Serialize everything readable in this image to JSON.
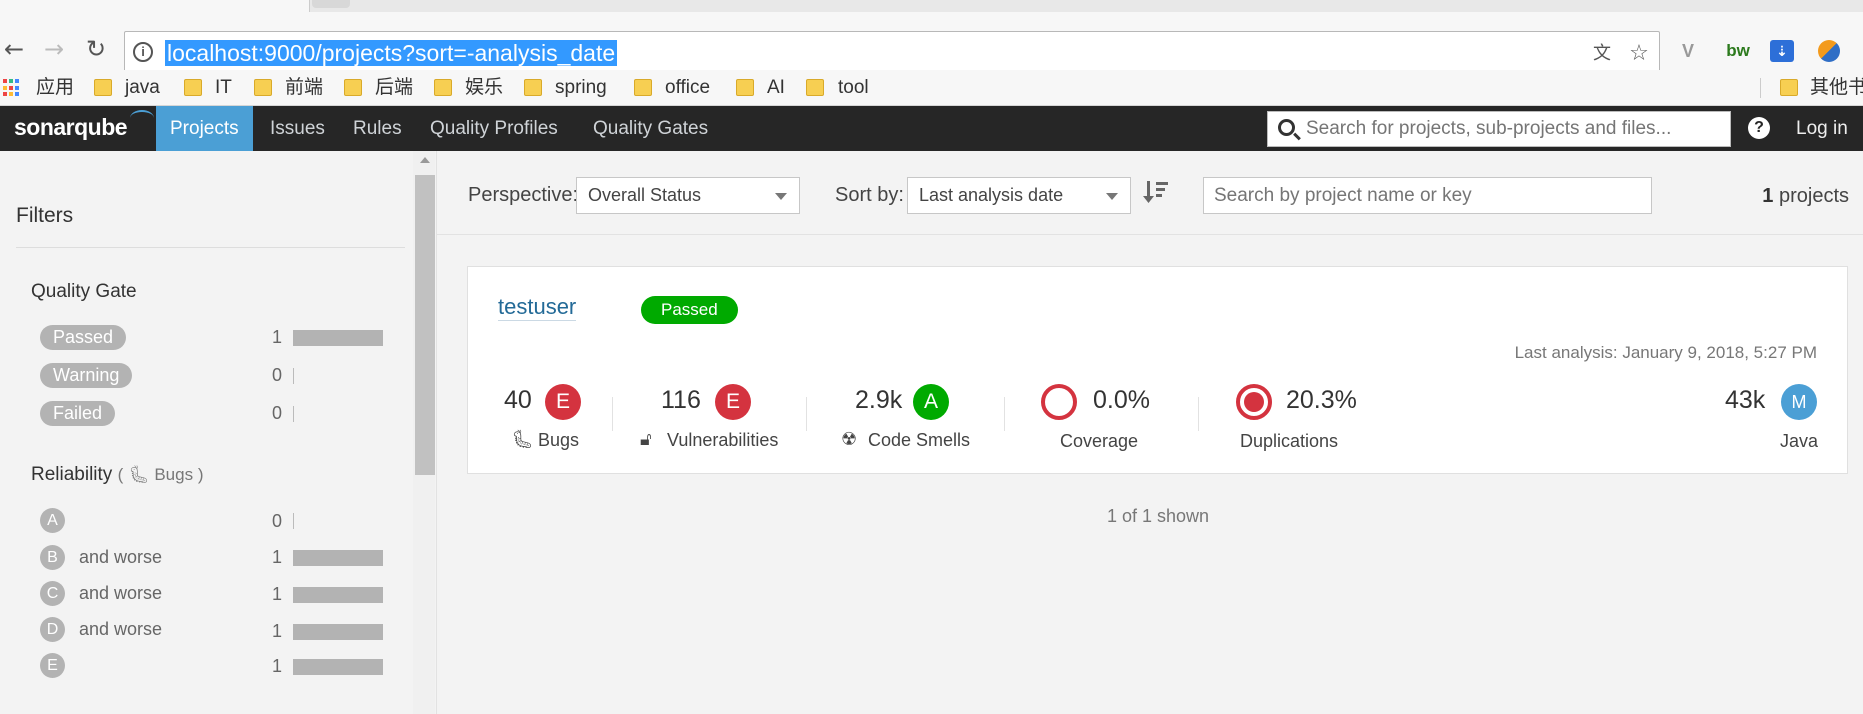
{
  "browser": {
    "url": "localhost:9000/projects?sort=-analysis_date",
    "icons": [
      "back-icon",
      "forward-icon",
      "reload-icon",
      "info-icon",
      "translate-icon",
      "star-icon"
    ],
    "extensions": [
      "vivaldi-icon",
      "bw-icon",
      "pocket-icon",
      "sync-icon"
    ],
    "ext_bw_label": "bw"
  },
  "bookmarks": {
    "apps_label": "应用",
    "folders": [
      "java",
      "IT",
      "前端",
      "后端",
      "娱乐",
      "spring",
      "office",
      "AI",
      "tool"
    ],
    "other_label": "其他书"
  },
  "nav": {
    "logo_text": "sonarqube",
    "items": [
      "Projects",
      "Issues",
      "Rules",
      "Quality Profiles",
      "Quality Gates"
    ],
    "active": "Projects",
    "search_placeholder": "Search for projects, sub-projects and files...",
    "help_label": "?",
    "login_label": "Log in",
    "accent_color": "#4b9fd5"
  },
  "sidebar": {
    "title": "Filters",
    "quality_gate": {
      "heading": "Quality Gate",
      "options": [
        {
          "label": "Passed",
          "count": "1",
          "fraction": 1
        },
        {
          "label": "Warning",
          "count": "0",
          "fraction": 0
        },
        {
          "label": "Failed",
          "count": "0",
          "fraction": 0
        }
      ]
    },
    "reliability": {
      "heading": "Reliability",
      "paren_open": "(",
      "paren_close": ")",
      "sub": "Bugs",
      "options": [
        {
          "grade": "A",
          "suffix": "",
          "count": "0",
          "fraction": 0
        },
        {
          "grade": "B",
          "suffix": "and worse",
          "count": "1",
          "fraction": 1
        },
        {
          "grade": "C",
          "suffix": "and worse",
          "count": "1",
          "fraction": 1
        },
        {
          "grade": "D",
          "suffix": "and worse",
          "count": "1",
          "fraction": 1
        },
        {
          "grade": "E",
          "suffix": "",
          "count": "1",
          "fraction": 1
        }
      ]
    }
  },
  "toolbar": {
    "perspective_label": "Perspective:",
    "perspective_value": "Overall Status",
    "sort_label": "Sort by:",
    "sort_value": "Last analysis date",
    "search_placeholder": "Search by project name or key",
    "count": "1",
    "count_suffix": "projects"
  },
  "project": {
    "name": "testuser",
    "quality_gate": "Passed",
    "last_analysis": "Last analysis: January 9, 2018, 5:27 PM",
    "bugs": {
      "value": "40",
      "rating": "E",
      "label": "Bugs"
    },
    "vulnerabilities": {
      "value": "116",
      "rating": "E",
      "label": "Vulnerabilities"
    },
    "code_smells": {
      "value": "2.9k",
      "rating": "A",
      "label": "Code Smells"
    },
    "coverage": {
      "value": "0.0%",
      "label": "Coverage"
    },
    "duplications": {
      "value": "20.3%",
      "label": "Duplications"
    },
    "size": {
      "value": "43k",
      "badge": "M",
      "label": "Java"
    }
  },
  "footer": {
    "shown": "1 of 1 shown"
  },
  "colors": {
    "passed": "#00aa00",
    "rating_e": "#d4333f",
    "rating_a": "#00aa00",
    "link": "#236a97"
  }
}
